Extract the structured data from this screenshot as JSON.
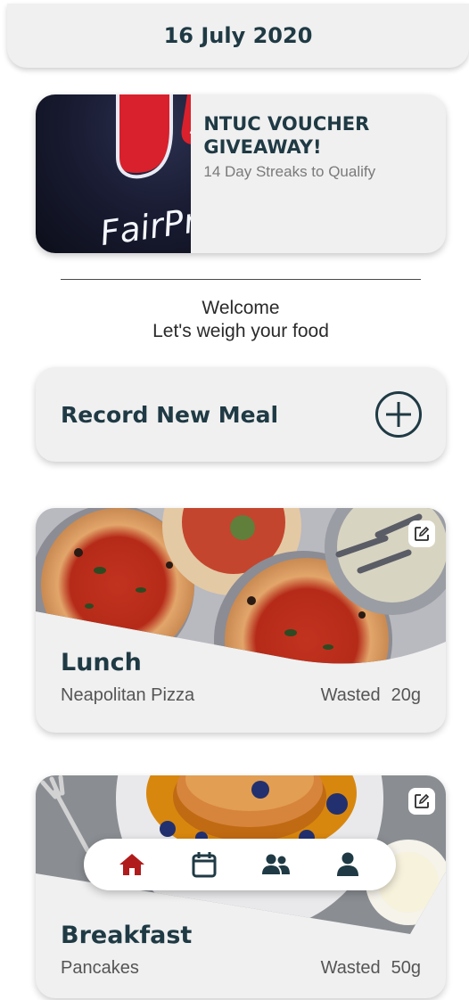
{
  "header": {
    "date": "16 July 2020"
  },
  "promo": {
    "brand_text": "FairPrice",
    "title": "NTUC VOUCHER GIVEAWAY!",
    "subtitle": "14 Day Streaks to Qualify"
  },
  "welcome": {
    "line1": "Welcome",
    "line2": "Let's weigh your food"
  },
  "record": {
    "label": "Record New Meal",
    "icon": "plus-circle-icon"
  },
  "meals": [
    {
      "title": "Lunch",
      "food": "Neapolitan Pizza",
      "wasted_label": "Wasted",
      "wasted_amount": "20g"
    },
    {
      "title": "Breakfast",
      "food": "Pancakes",
      "wasted_label": "Wasted",
      "wasted_amount": "50g"
    }
  ],
  "nav": {
    "items": [
      "home-icon",
      "calendar-icon",
      "people-icon",
      "profile-icon"
    ],
    "active": "home-icon"
  },
  "colors": {
    "accent": "#1f3a44",
    "active_nav": "#b01c1c",
    "card_bg": "#f0f0f0"
  }
}
